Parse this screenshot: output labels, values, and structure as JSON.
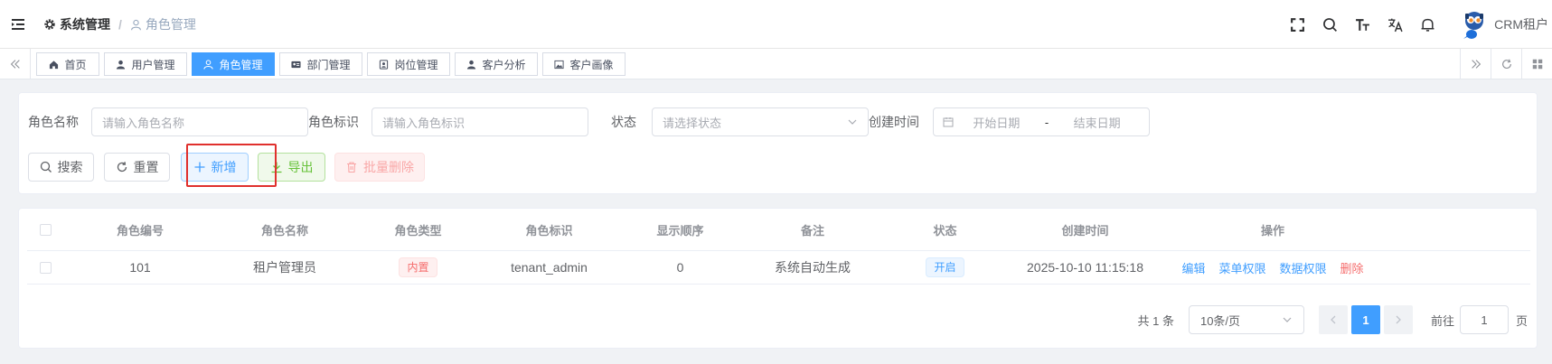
{
  "header": {
    "breadcrumb": {
      "parent": "系统管理",
      "sep": "/",
      "current": "角色管理"
    },
    "tenant": "CRM租户",
    "icons": [
      "hamburger-icon",
      "gear-icon",
      "user-icon",
      "fullscreen-icon",
      "search-icon",
      "font-size-icon",
      "translate-icon",
      "bell-icon"
    ]
  },
  "tags": [
    {
      "label": "首页",
      "icon": "home-icon",
      "active": false
    },
    {
      "label": "用户管理",
      "icon": "user-icon",
      "active": false
    },
    {
      "label": "角色管理",
      "icon": "user-icon",
      "active": true
    },
    {
      "label": "部门管理",
      "icon": "id-card-icon",
      "active": false
    },
    {
      "label": "岗位管理",
      "icon": "badge-icon",
      "active": false
    },
    {
      "label": "客户分析",
      "icon": "user-icon",
      "active": false
    },
    {
      "label": "客户画像",
      "icon": "picture-icon",
      "active": false
    }
  ],
  "search": {
    "role_name_label": "角色名称",
    "role_name_placeholder": "请输入角色名称",
    "role_key_label": "角色标识",
    "role_key_placeholder": "请输入角色标识",
    "status_label": "状态",
    "status_placeholder": "请选择状态",
    "created_label": "创建时间",
    "start_placeholder": "开始日期",
    "date_sep": "-",
    "end_placeholder": "结束日期"
  },
  "buttons": {
    "search": "搜索",
    "reset": "重置",
    "add": "新增",
    "export": "导出",
    "batch_delete": "批量删除"
  },
  "table": {
    "columns": [
      "角色编号",
      "角色名称",
      "角色类型",
      "角色标识",
      "显示顺序",
      "备注",
      "状态",
      "创建时间",
      "操作"
    ],
    "rows": [
      {
        "id": "101",
        "name": "租户管理员",
        "type": "内置",
        "key": "tenant_admin",
        "order": "0",
        "remark": "系统自动生成",
        "status": "开启",
        "created": "2025-10-10 11:15:18",
        "ops": [
          "编辑",
          "菜单权限",
          "数据权限",
          "删除"
        ]
      }
    ]
  },
  "pagination": {
    "total": "共 1 条",
    "page_size": "10条/页",
    "current_page": "1",
    "goto_label": "前往",
    "goto_value": "1",
    "page_unit": "页"
  },
  "colors": {
    "primary": "#409eff",
    "success": "#67c23a",
    "danger": "#f56c6c",
    "highlight": "#e0302d"
  }
}
